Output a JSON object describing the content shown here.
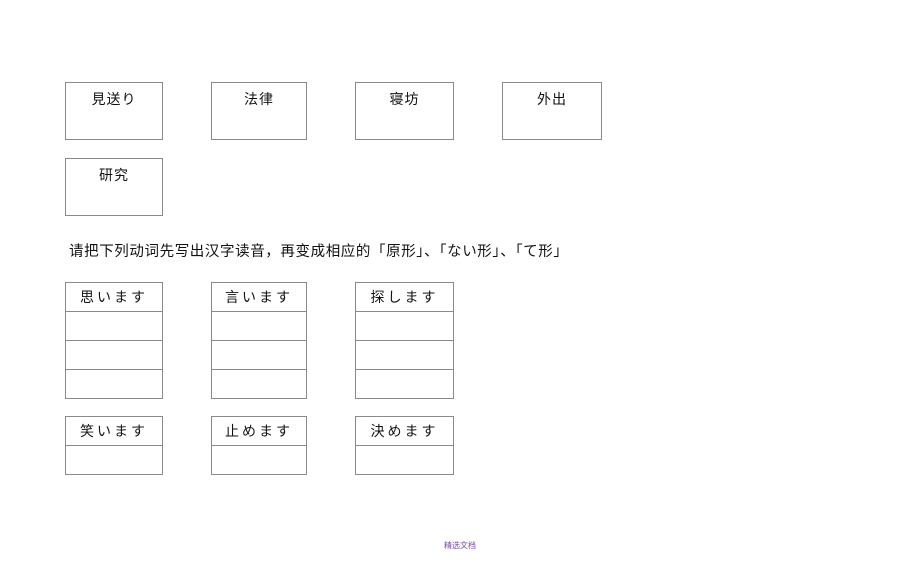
{
  "vocab_boxes": [
    {
      "word": "見送り"
    },
    {
      "word": "法律"
    },
    {
      "word": "寝坊"
    },
    {
      "word": "外出"
    },
    {
      "word": "研究"
    }
  ],
  "instruction": "请把下列动词先写出汉字读音，再变成相应的「原形」、「ない形」、「て形」",
  "verb_tables_large": [
    {
      "verb": "思います",
      "answers": [
        "",
        "",
        ""
      ]
    },
    {
      "verb": "言います",
      "answers": [
        "",
        "",
        ""
      ]
    },
    {
      "verb": "探します",
      "answers": [
        "",
        "",
        ""
      ]
    }
  ],
  "verb_tables_small": [
    {
      "verb": "笑います",
      "answers": [
        ""
      ]
    },
    {
      "verb": "止めます",
      "answers": [
        ""
      ]
    },
    {
      "verb": "決めます",
      "answers": [
        ""
      ]
    }
  ],
  "footer": "精选文档"
}
